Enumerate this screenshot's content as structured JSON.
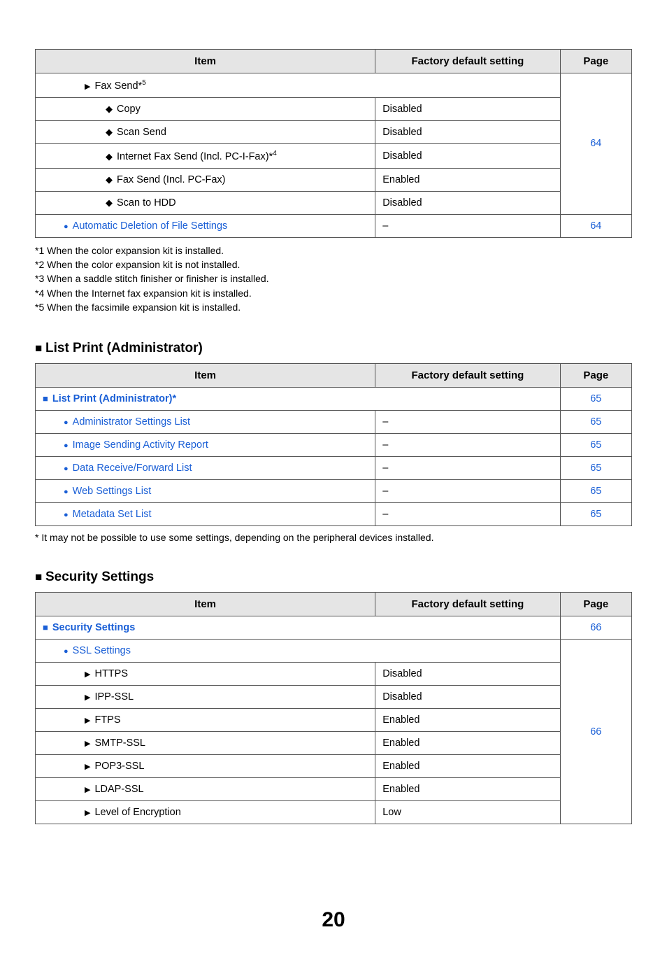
{
  "headers": {
    "item": "Item",
    "setting": "Factory default setting",
    "page": "Page"
  },
  "table1": {
    "fax_send": "Fax Send*",
    "fax_send_sup": "5",
    "rows": [
      {
        "label": "Copy",
        "value": "Disabled",
        "marker": "diamond"
      },
      {
        "label": "Scan Send",
        "value": "Disabled",
        "marker": "diamond"
      },
      {
        "label": "Internet Fax Send (Incl. PC-I-Fax)*",
        "sup": "4",
        "value": "Disabled",
        "marker": "diamond"
      },
      {
        "label": "Fax Send (Incl. PC-Fax)",
        "value": "Enabled",
        "marker": "diamond"
      },
      {
        "label": "Scan to HDD",
        "value": "Disabled",
        "marker": "diamond"
      }
    ],
    "page_group": "64",
    "last_row": {
      "label": "Automatic Deletion of File Settings",
      "value": "–",
      "page": "64"
    }
  },
  "footnotes1": [
    "*1  When the color expansion kit is installed.",
    "*2  When the color expansion kit is not installed.",
    "*3  When a saddle stitch finisher or finisher is installed.",
    "*4  When the Internet fax expansion kit is installed.",
    "*5  When the facsimile expansion kit is installed."
  ],
  "section2": {
    "heading": "List Print (Administrator)",
    "top": {
      "label": "List Print (Administrator)*",
      "page": "65"
    },
    "rows": [
      {
        "label": "Administrator Settings List",
        "value": "–",
        "page": "65"
      },
      {
        "label": "Image Sending Activity Report",
        "value": "–",
        "page": "65"
      },
      {
        "label": "Data Receive/Forward List",
        "value": "–",
        "page": "65"
      },
      {
        "label": "Web Settings List",
        "value": "–",
        "page": "65"
      },
      {
        "label": "Metadata Set List",
        "value": "–",
        "page": "65"
      }
    ]
  },
  "footnote2": "*  It may not be possible to use some settings, depending on the peripheral devices installed.",
  "section3": {
    "heading": "Security Settings",
    "top": {
      "label": "Security Settings",
      "page": "66"
    },
    "ssl_label": "SSL Settings",
    "rows": [
      {
        "label": "HTTPS",
        "value": "Disabled"
      },
      {
        "label": "IPP-SSL",
        "value": "Disabled"
      },
      {
        "label": "FTPS",
        "value": "Enabled"
      },
      {
        "label": "SMTP-SSL",
        "value": "Enabled"
      },
      {
        "label": "POP3-SSL",
        "value": "Enabled"
      },
      {
        "label": "LDAP-SSL",
        "value": "Enabled"
      },
      {
        "label": "Level of Encryption",
        "value": "Low"
      }
    ],
    "page_group": "66"
  },
  "page_number": "20"
}
